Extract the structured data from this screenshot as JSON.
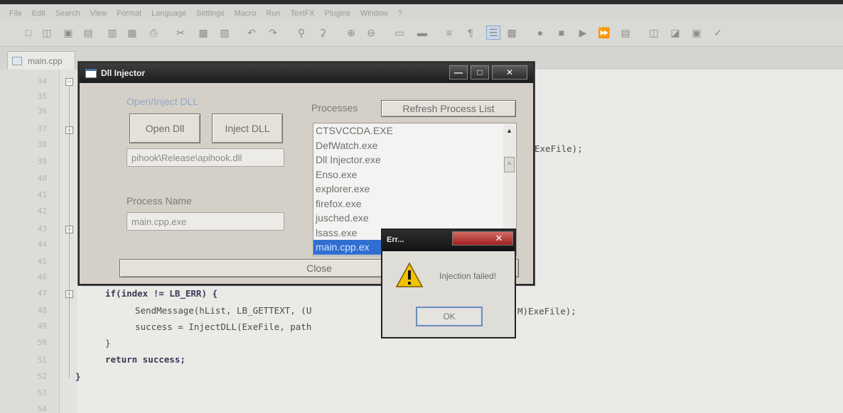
{
  "menu": [
    "File",
    "Edit",
    "Search",
    "View",
    "Format",
    "Language",
    "Settings",
    "Macro",
    "Run",
    "TextFX",
    "Plugins",
    "Window",
    "?"
  ],
  "tab": {
    "label": "main.cpp"
  },
  "editor": {
    "line_numbers": [
      "34",
      "35",
      "36",
      "37",
      "38",
      "39",
      "40",
      "41",
      "42",
      "43",
      "44",
      "45",
      "46",
      "47",
      "48",
      "49",
      "50",
      "51",
      "52",
      "53",
      "54"
    ],
    "code": {
      "l38_tail": "ExeFile);",
      "l47": "if(index != LB_ERR) {",
      "l48": "SendMessage(hList, LB_GETTEXT, (U",
      "l48_tail": "M)ExeFile);",
      "l49": "success = InjectDLL(ExeFile, path",
      "l50": "}",
      "l51": "return success;",
      "l52": "}"
    }
  },
  "injector": {
    "title": "Dll Injector",
    "open_inject_label": "Open/Inject DLL",
    "open_button": "Open Dll",
    "inject_button": "Inject DLL",
    "dll_path": "pihook\\Release\\apihook.dll",
    "process_name_label": "Process Name",
    "process_name_value": "main.cpp.exe",
    "processes_label": "Processes",
    "refresh_button": "Refresh Process List",
    "processes": [
      "CTSVCCDA.EXE",
      "DefWatch.exe",
      "Dll Injector.exe",
      "Enso.exe",
      "explorer.exe",
      "firefox.exe",
      "jusched.exe",
      "lsass.exe",
      "main.cpp.ex"
    ],
    "selected_process": "main.cpp.ex",
    "close_button": "Close"
  },
  "error_dialog": {
    "title": "Err...",
    "message": "Injection failed!",
    "ok_button": "OK"
  }
}
